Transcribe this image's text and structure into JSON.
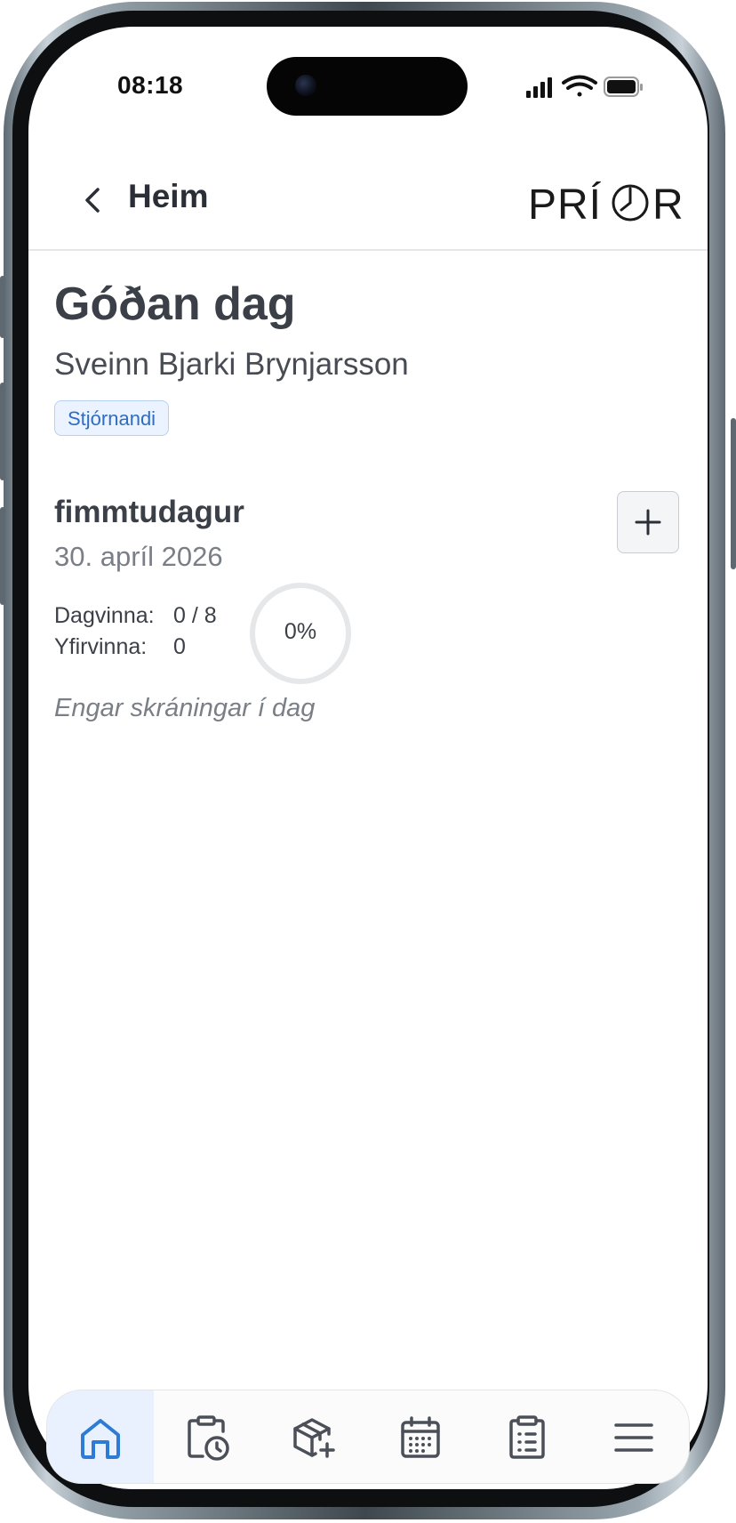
{
  "status_bar": {
    "time": "08:18",
    "icons": [
      "signal-icon",
      "wifi-icon",
      "battery-icon"
    ]
  },
  "header": {
    "back_icon": "chevron-left-icon",
    "title": "Heim",
    "logo_text": "PRÍOR"
  },
  "greeting": {
    "title": "Góðan dag",
    "user_name": "Sveinn Bjarki Brynjarsson",
    "role": "Stjórnandi"
  },
  "day": {
    "weekday": "fimmtudagur",
    "date": "30. apríl 2026",
    "add_icon": "plus-icon",
    "day_work_label": "Dagvinna:",
    "day_work_value": "0 / 8",
    "overtime_label": "Yfirvinna:",
    "overtime_value": "0",
    "progress_percent": 0,
    "progress_text": "0%",
    "empty_text": "Engar skráningar í dag"
  },
  "bottom_nav": {
    "items": [
      {
        "icon": "home-icon",
        "active": true
      },
      {
        "icon": "clipboard-clock-icon",
        "active": false
      },
      {
        "icon": "package-add-icon",
        "active": false
      },
      {
        "icon": "calendar-icon",
        "active": false
      },
      {
        "icon": "clipboard-list-icon",
        "active": false
      },
      {
        "icon": "menu-icon",
        "active": false
      }
    ]
  },
  "colors": {
    "accent": "#2e7bd6",
    "text_dark": "#3b3f47",
    "text_muted": "#7a7e86",
    "badge_bg": "#eaf3ff",
    "active_nav_bg": "#e8f1fd",
    "ring_track": "#e6e7e9"
  }
}
